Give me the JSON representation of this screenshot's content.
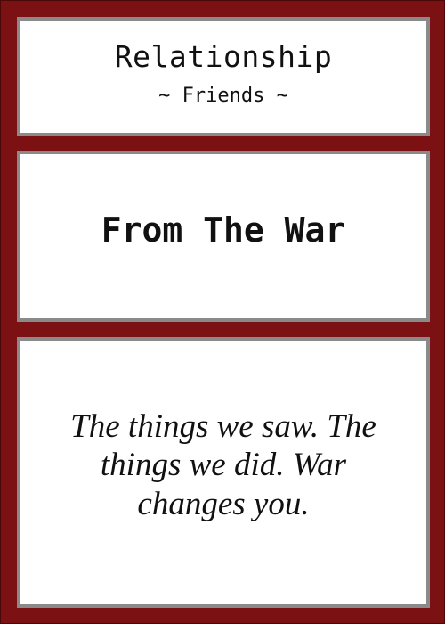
{
  "card": {
    "category": "Relationship",
    "subcategory": "~ Friends ~",
    "title": "From The War",
    "quote": "The things we saw. The things we did. War changes you."
  },
  "colors": {
    "frame": "#7b1113",
    "panel_border": "#8a8a8a",
    "panel_background": "#ffffff",
    "text": "#111111"
  }
}
